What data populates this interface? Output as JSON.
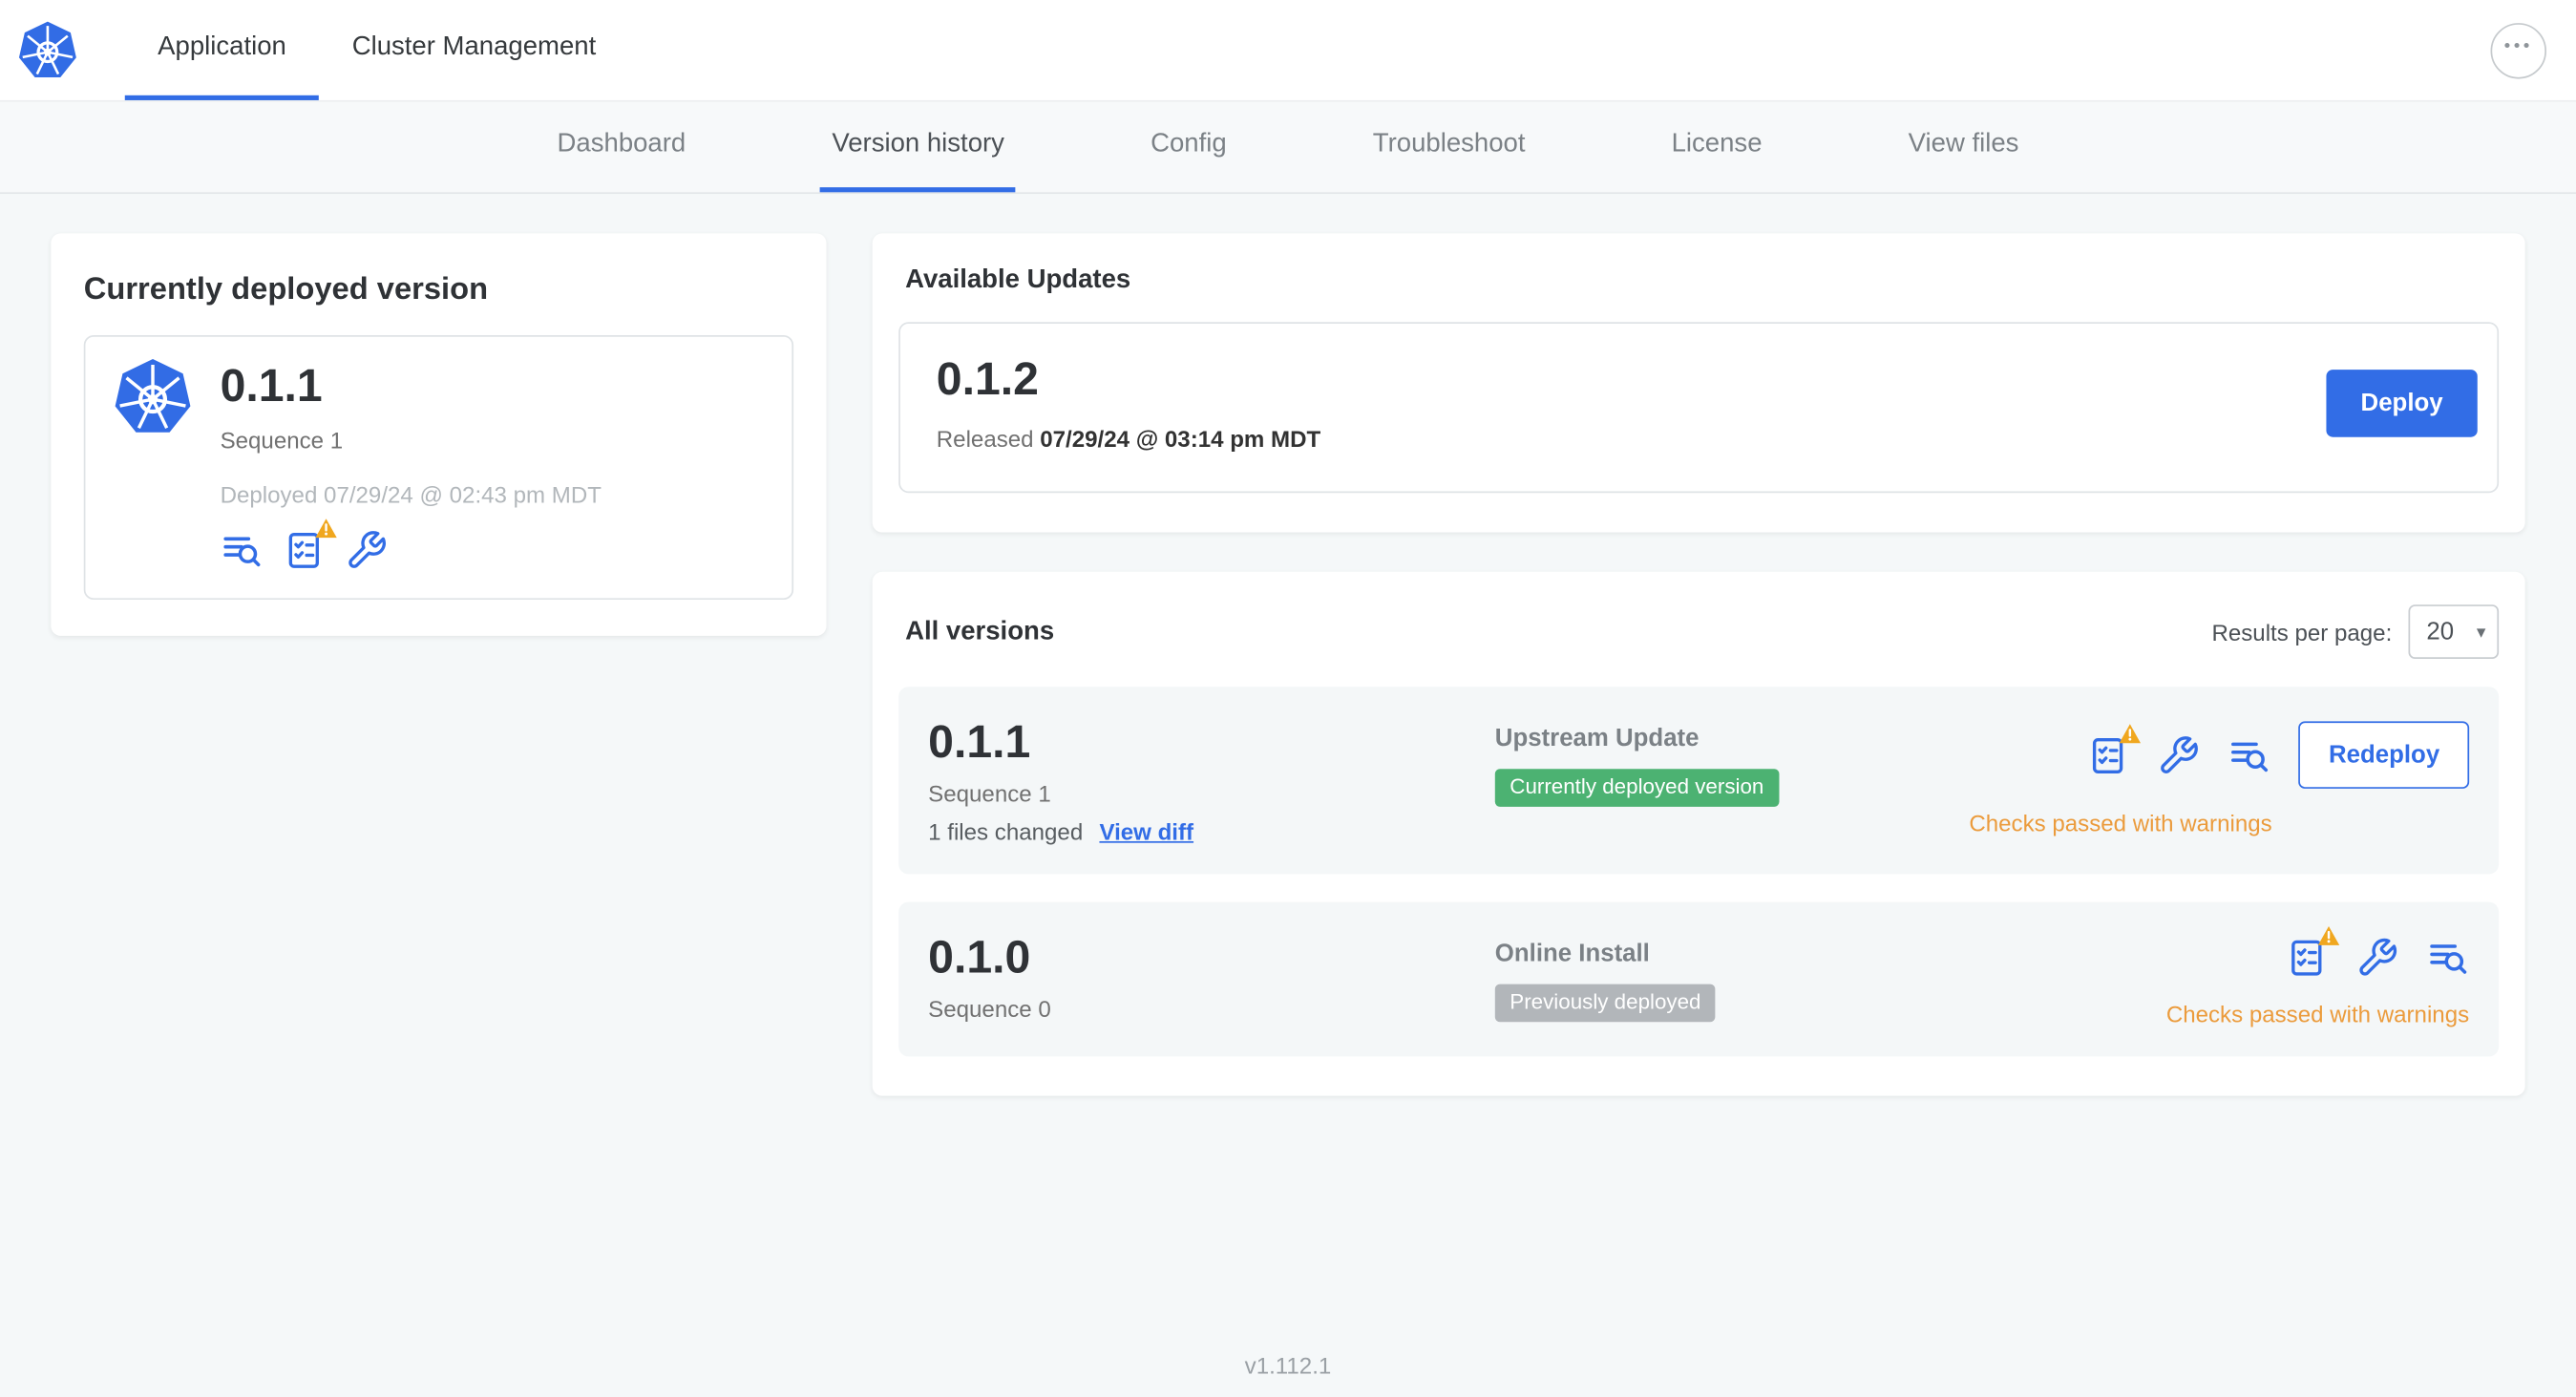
{
  "header": {
    "tabs": [
      {
        "label": "Application"
      },
      {
        "label": "Cluster Management"
      }
    ]
  },
  "subnav": {
    "tabs": [
      {
        "label": "Dashboard"
      },
      {
        "label": "Version history"
      },
      {
        "label": "Config"
      },
      {
        "label": "Troubleshoot"
      },
      {
        "label": "License"
      },
      {
        "label": "View files"
      }
    ]
  },
  "current_version": {
    "title": "Currently deployed version",
    "version": "0.1.1",
    "sequence": "Sequence 1",
    "deployed": "Deployed 07/29/24 @ 02:43 pm MDT"
  },
  "available_updates": {
    "title": "Available Updates",
    "version": "0.1.2",
    "released_prefix": "Released",
    "released_date": "07/29/24 @ 03:14 pm MDT",
    "deploy_label": "Deploy"
  },
  "all_versions": {
    "title": "All versions",
    "results_per_page_label": "Results per page:",
    "results_per_page_value": "20",
    "rows": [
      {
        "version": "0.1.1",
        "sequence": "Sequence 1",
        "files_changed": "1 files changed",
        "view_diff_label": "View diff",
        "source_type": "Upstream Update",
        "badge_label": "Currently deployed version",
        "badge_style": "green",
        "status_text": "Checks passed with warnings",
        "action_label": "Redeploy"
      },
      {
        "version": "0.1.0",
        "sequence": "Sequence 0",
        "source_type": "Online Install",
        "badge_label": "Previously deployed",
        "badge_style": "gray",
        "status_text": "Checks passed with warnings"
      }
    ]
  },
  "footer": {
    "version": "v1.112.1"
  },
  "colors": {
    "primary_blue": "#326de6",
    "logo_blue": "#326ce5",
    "badge_green": "#4cb272",
    "badge_gray": "#b2b6ba",
    "warning_orange": "#eb9b3c",
    "page_background": "#f5f8f9"
  },
  "icons": {
    "logo": "kubernetes-logo-icon",
    "overflow": "ellipsis-icon",
    "diff": "diff-lines-magnifier-icon",
    "preflight": "checklist-icon",
    "preflight_warning": "warning-triangle-icon",
    "config": "wrench-icon",
    "select_chevron": "chevron-down-icon"
  }
}
